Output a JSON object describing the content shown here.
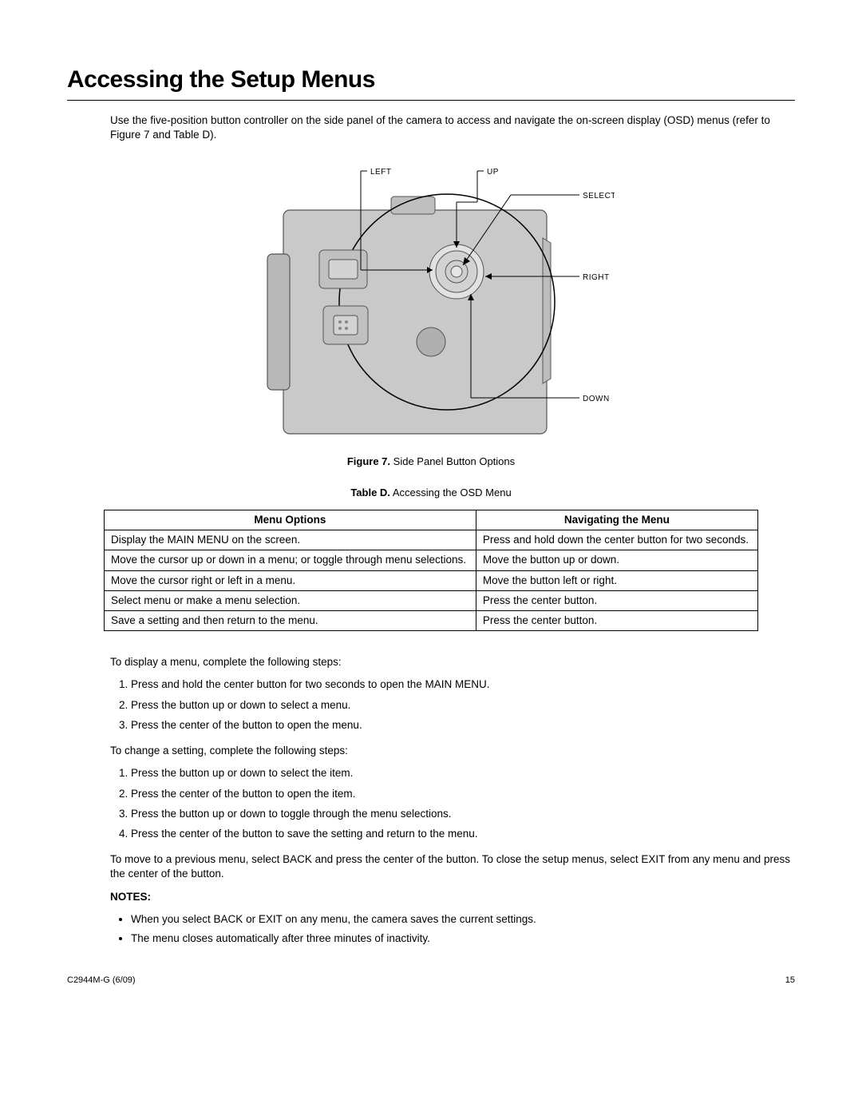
{
  "heading": "Accessing the Setup Menus",
  "intro": "Use the five-position button controller on the side panel of the camera to access and navigate the on-screen display (OSD) menus (refer to Figure 7 and Table D).",
  "diagram": {
    "labels": {
      "left": "LEFT",
      "up": "UP",
      "select": "SELECT",
      "right": "RIGHT",
      "down": "DOWN"
    }
  },
  "figure_caption": {
    "prefix": "Figure 7.",
    "text": "Side Panel Button Options"
  },
  "table_caption": {
    "prefix": "Table D.",
    "text": "Accessing the OSD Menu"
  },
  "table": {
    "headers": [
      "Menu Options",
      "Navigating the Menu"
    ],
    "rows": [
      [
        "Display the MAIN MENU on the screen.",
        "Press and hold down the center button for two seconds."
      ],
      [
        "Move the cursor up or down in a menu; or toggle through menu selections.",
        "Move the button up or down."
      ],
      [
        "Move the cursor right or left in a menu.",
        "Move the button left or right."
      ],
      [
        "Select menu or make a menu selection.",
        "Press the center button."
      ],
      [
        "Save a setting and then return to the menu.",
        "Press the center button."
      ]
    ]
  },
  "display_intro": "To display a menu, complete the following steps:",
  "display_steps": [
    "Press and hold the center button for two seconds to open the MAIN MENU.",
    "Press the button up or down to select a menu.",
    "Press the center of the button to open the menu."
  ],
  "change_intro": "To change a setting, complete the following steps:",
  "change_steps": [
    "Press the button up or down to select the item.",
    "Press the center of the button to open the item.",
    "Press the button up or down to toggle through the menu selections.",
    "Press the center of the button to save the setting and return to the menu."
  ],
  "back_exit": "To move to a previous menu, select BACK and press the center of the button. To close the setup menus, select EXIT from any menu and press the center of the button.",
  "notes_label": "NOTES:",
  "notes": [
    "When you select BACK or EXIT on any menu, the camera saves the current settings.",
    "The menu closes automatically after three minutes of inactivity."
  ],
  "footer": {
    "left": "C2944M-G (6/09)",
    "right": "15"
  }
}
